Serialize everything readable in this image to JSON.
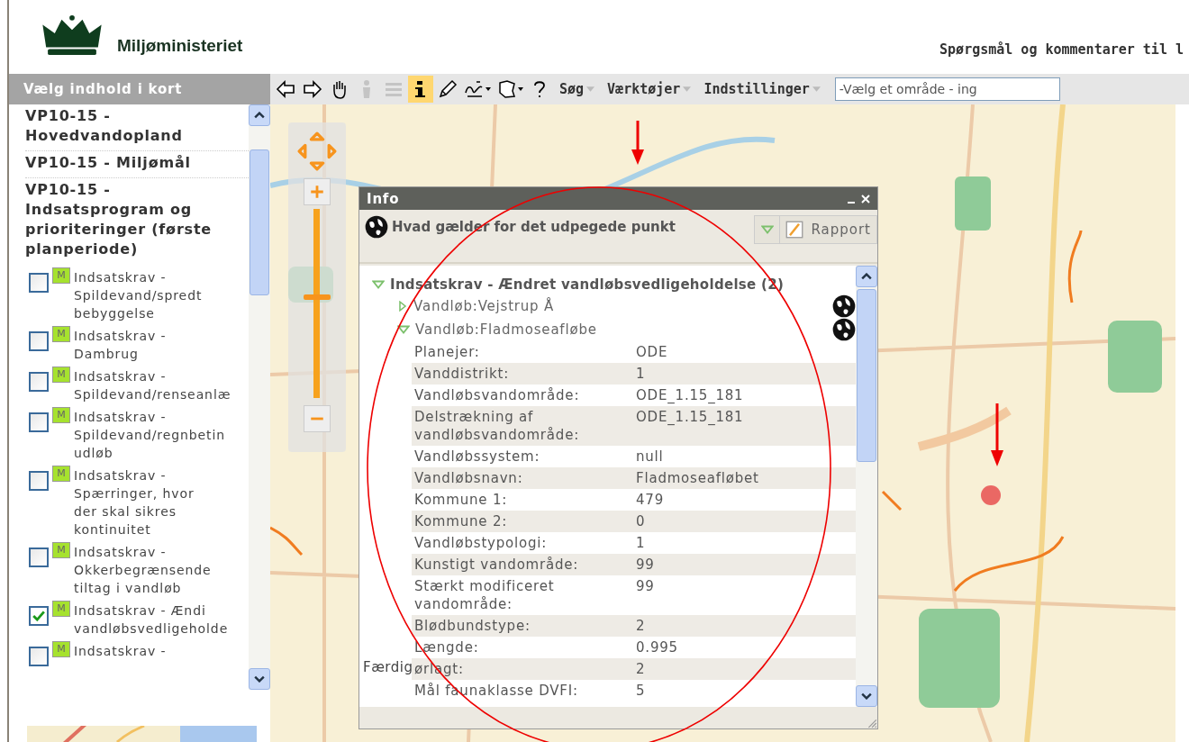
{
  "header": {
    "org_name": "Miljøministeriet",
    "feedback_link": "Spørgsmål og kommentarer til l"
  },
  "toolbar": {
    "sidebar_title": "Vælg indhold i kort",
    "tools": [
      {
        "kind": "back",
        "selected": false,
        "disabled": false
      },
      {
        "kind": "forward",
        "selected": false,
        "disabled": false
      },
      {
        "kind": "pan",
        "selected": false,
        "disabled": false
      },
      {
        "kind": "person",
        "selected": false,
        "disabled": true
      },
      {
        "kind": "layers",
        "selected": false,
        "disabled": true
      },
      {
        "kind": "info",
        "selected": true,
        "disabled": false
      },
      {
        "kind": "pen",
        "selected": false,
        "disabled": false
      },
      {
        "kind": "draw",
        "selected": false,
        "disabled": false
      },
      {
        "kind": "shape",
        "selected": false,
        "disabled": false
      },
      {
        "kind": "help",
        "selected": false,
        "disabled": false
      }
    ],
    "menus": [
      "Søg",
      "Værktøjer",
      "Indstillinger"
    ],
    "area_select": {
      "placeholder": "-Vælg et område - ing"
    }
  },
  "sidebar": {
    "groups": [
      "VP10-15 - Hovedvandopland",
      "VP10-15 - Miljømål",
      "VP10-15 - Indsatsprogram og prioriteringer (første planperiode)"
    ],
    "layers": [
      {
        "lines": [
          "Indsatskrav -",
          "Spildevand/spredt",
          "bebyggelse"
        ],
        "legend": "M",
        "checked": false
      },
      {
        "lines": [
          "Indsatskrav -",
          "Dambrug"
        ],
        "legend": "M",
        "checked": false
      },
      {
        "lines": [
          "Indsatskrav -",
          "Spildevand/renseanlæ"
        ],
        "legend": "M",
        "checked": false
      },
      {
        "lines": [
          "Indsatskrav -",
          "Spildevand/regnbetin",
          "udløb"
        ],
        "legend": "M",
        "checked": false
      },
      {
        "lines": [
          "Indsatskrav -",
          "Spærringer, hvor",
          "der skal sikres",
          "kontinuitet"
        ],
        "legend": "M",
        "checked": false
      },
      {
        "lines": [
          "Indsatskrav -",
          "Okkerbegrænsende",
          "tiltag i vandløb"
        ],
        "legend": "M",
        "checked": false
      },
      {
        "lines": [
          "Indsatskrav - Ændi",
          "vandløbsvedligeholde"
        ],
        "legend": "M",
        "checked": true
      },
      {
        "lines": [
          "Indsatskrav -"
        ],
        "legend": "M",
        "checked": false
      }
    ]
  },
  "map": {
    "zoom": {
      "level": 0.52
    }
  },
  "info_window": {
    "title": "Info",
    "heading": "Hvad gælder for det udpegede punkt",
    "report_button": "Rapport",
    "group": {
      "label": "Indsatskrav - Ændret vandløbsvedligeholdelse (2)",
      "expanded": true,
      "children": [
        {
          "label": "Vandløb:Vejstrup Å",
          "expanded": false
        },
        {
          "label": "Vandløb:Fladmoseafløbe",
          "expanded": true,
          "attributes": [
            {
              "name": "Planejer:",
              "value": "ODE"
            },
            {
              "name": "Vanddistrikt:",
              "value": "1"
            },
            {
              "name": "Vandløbsvandområde:",
              "value": "ODE_1.15_181"
            },
            {
              "name": "Delstrækning af vandløbsvandområde:",
              "value": "ODE_1.15_181"
            },
            {
              "name": "Vandløbssystem:",
              "value": "null"
            },
            {
              "name": "Vandløbsnavn:",
              "value": "Fladmoseafløbet"
            },
            {
              "name": "Kommune 1:",
              "value": "479"
            },
            {
              "name": "Kommune 2:",
              "value": "0"
            },
            {
              "name": "Vandløbstypologi:",
              "value": "1"
            },
            {
              "name": "Kunstigt vandområde:",
              "value": "99"
            },
            {
              "name": "Stærkt modificeret vandområde:",
              "value": "99"
            },
            {
              "name": "Blødbundstype:",
              "value": "2"
            },
            {
              "name": "Længde:",
              "value": "0.995"
            },
            {
              "name": "ørlagt:",
              "value": "2"
            },
            {
              "name": "Mål faunaklasse DVFI:",
              "value": "5"
            }
          ]
        }
      ]
    }
  },
  "status_text": "Færdig"
}
